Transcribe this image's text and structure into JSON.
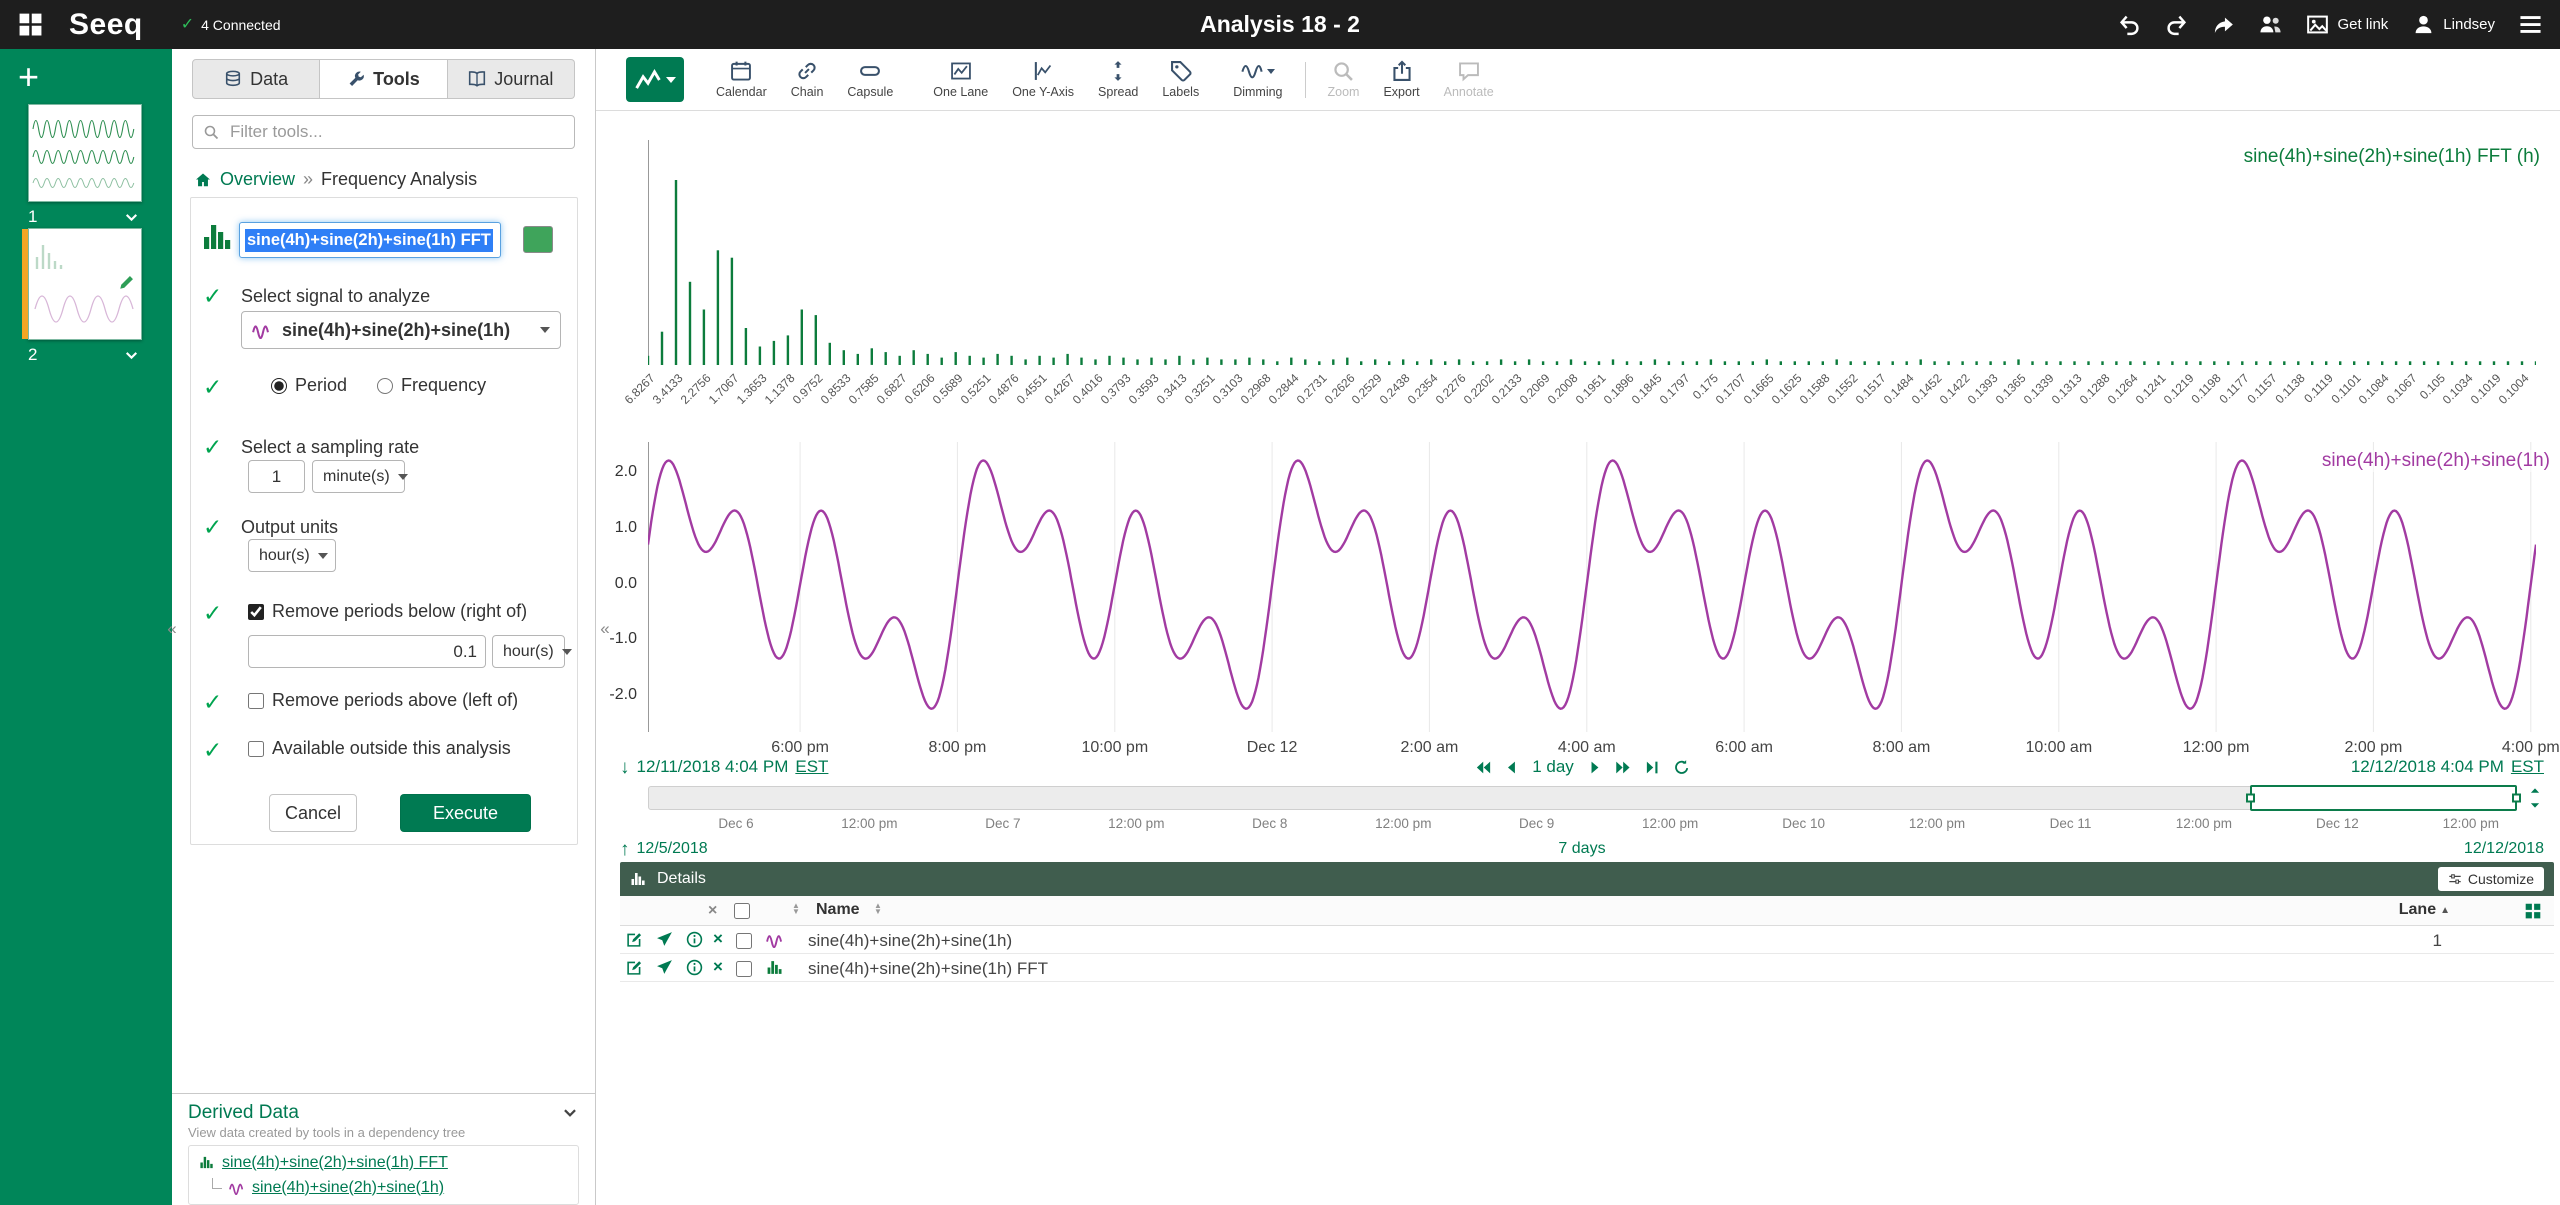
{
  "colors": {
    "accent_green": "#007a52",
    "sidebar_green": "#008659",
    "topbar_bg": "#1e1e1e",
    "fft_bar_green": "#0c7c3c",
    "signal_purple": "#a23ba2",
    "selection_blue": "#2f7ff6",
    "details_header_bg": "#405d4e",
    "active_worksheet_orange": "#f5a623",
    "swatch_green": "#3fa45b"
  },
  "topbar": {
    "logo": "Seeq",
    "connected_label": "4 Connected",
    "title": "Analysis 18 - 2",
    "get_link_label": "Get link",
    "user_name": "Lindsey"
  },
  "sidebar": {
    "worksheets": [
      {
        "number": "1"
      },
      {
        "number": "2",
        "active": true
      }
    ]
  },
  "toolpanel": {
    "tabs": {
      "data": "Data",
      "tools": "Tools",
      "journal": "Journal"
    },
    "filter_placeholder": "Filter tools...",
    "breadcrumb": {
      "root": "Overview",
      "separator": "»",
      "current": "Frequency Analysis"
    },
    "form": {
      "name_value": "sine(4h)+sine(2h)+sine(1h) FFT",
      "signal_label": "Select signal to analyze",
      "signal_value": "sine(4h)+sine(2h)+sine(1h)",
      "radio_period": "Period",
      "radio_frequency": "Frequency",
      "period_selected": true,
      "sampling_label": "Select a sampling rate",
      "sampling_value": "1",
      "sampling_unit": "minute(s)",
      "output_label": "Output units",
      "output_unit": "hour(s)",
      "below_label": "Remove periods below (right of)",
      "below_checked": true,
      "below_value": "0.1",
      "below_unit": "hour(s)",
      "above_label": "Remove periods above (left of)",
      "above_checked": false,
      "available_label": "Available outside this analysis",
      "available_checked": false,
      "cancel_label": "Cancel",
      "execute_label": "Execute"
    },
    "derived": {
      "title": "Derived Data",
      "subtitle": "View data created by tools in a dependency tree",
      "items": [
        "sine(4h)+sine(2h)+sine(1h) FFT",
        "sine(4h)+sine(2h)+sine(1h)"
      ]
    }
  },
  "toolbar": {
    "items": [
      {
        "label": "Calendar",
        "disabled": false
      },
      {
        "label": "Chain",
        "disabled": false
      },
      {
        "label": "Capsule",
        "disabled": false
      },
      {
        "label": "One Lane",
        "disabled": false
      },
      {
        "label": "One Y-Axis",
        "disabled": false
      },
      {
        "label": "Spread",
        "disabled": false
      },
      {
        "label": "Labels",
        "disabled": false
      },
      {
        "label": "Dimming",
        "disabled": false
      },
      {
        "label": "Zoom",
        "disabled": true
      },
      {
        "label": "Export",
        "disabled": false
      },
      {
        "label": "Annotate",
        "disabled": true
      }
    ]
  },
  "chart_data": [
    {
      "type": "bar",
      "series_label": "sine(4h)+sine(2h)+sine(1h) FFT (h)",
      "x_axis": "period in hours, descending (period = 6.8267/k)",
      "x_tick_labels": [
        "6.8267",
        "3.4133",
        "2.2756",
        "1.7067",
        "1.3653",
        "1.1378",
        "0.9752",
        "0.8533",
        "0.7585",
        "0.6827",
        "0.6206",
        "0.5689",
        "0.5251",
        "0.4876",
        "0.4551",
        "0.4267",
        "0.4016",
        "0.3793",
        "0.3593",
        "0.3413",
        "0.3251",
        "0.3103",
        "0.2968",
        "0.2844",
        "0.2731",
        "0.2626",
        "0.2529",
        "0.2438",
        "0.2354",
        "0.2276",
        "0.2202",
        "0.2133",
        "0.2069",
        "0.2008",
        "0.1951",
        "0.1896",
        "0.1845",
        "0.1797",
        "0.175",
        "0.1707",
        "0.1665",
        "0.1625",
        "0.1588",
        "0.1552",
        "0.1517",
        "0.1484",
        "0.1452",
        "0.1422",
        "0.1393",
        "0.1365",
        "0.1339",
        "0.1313",
        "0.1288",
        "0.1264",
        "0.1241",
        "0.1219",
        "0.1198",
        "0.1177",
        "0.1157",
        "0.1138",
        "0.1119",
        "0.1101",
        "0.1084",
        "0.1067",
        "0.105",
        "0.1034",
        "0.1019",
        "0.1004"
      ],
      "bins_per_label": 2,
      "values": [
        0.05,
        0.18,
        1.0,
        0.45,
        0.3,
        0.62,
        0.58,
        0.2,
        0.1,
        0.13,
        0.16,
        0.3,
        0.27,
        0.12,
        0.08,
        0.06,
        0.09,
        0.07,
        0.05,
        0.08,
        0.06,
        0.04,
        0.07,
        0.05,
        0.04,
        0.06,
        0.05,
        0.03,
        0.05,
        0.04,
        0.06,
        0.04,
        0.03,
        0.05,
        0.04,
        0.03,
        0.04,
        0.03,
        0.05,
        0.03,
        0.04,
        0.03,
        0.03,
        0.04,
        0.03,
        0.02,
        0.04,
        0.03,
        0.02,
        0.03,
        0.04,
        0.02,
        0.03,
        0.02,
        0.03,
        0.02,
        0.03,
        0.02,
        0.03,
        0.02,
        0.02,
        0.03,
        0.02,
        0.03,
        0.02,
        0.02,
        0.03,
        0.02,
        0.02,
        0.03,
        0.02,
        0.02,
        0.03,
        0.02,
        0.02,
        0.02,
        0.03,
        0.02,
        0.02,
        0.02,
        0.03,
        0.02,
        0.02,
        0.02,
        0.02,
        0.03,
        0.02,
        0.02,
        0.02,
        0.02,
        0.02,
        0.03,
        0.02,
        0.02,
        0.02,
        0.02,
        0.02,
        0.02,
        0.03,
        0.02,
        0.02,
        0.02,
        0.02,
        0.02,
        0.02,
        0.02,
        0.02,
        0.02,
        0.02,
        0.02,
        0.02,
        0.02,
        0.02,
        0.02,
        0.02,
        0.02,
        0.02,
        0.02,
        0.02,
        0.02,
        0.02,
        0.02,
        0.02,
        0.02,
        0.02,
        0.02,
        0.02,
        0.02,
        0.02,
        0.02,
        0.02,
        0.02,
        0.02,
        0.02,
        0.02,
        0.02
      ],
      "ylim": [
        0,
        1
      ],
      "peaks_at_period_hours": [
        4,
        2,
        1
      ]
    },
    {
      "type": "line",
      "series_label": "sine(4h)+sine(2h)+sine(1h)",
      "components": [
        {
          "period_hours": 4,
          "amplitude": 1
        },
        {
          "period_hours": 2,
          "amplitude": 1
        },
        {
          "period_hours": 1,
          "amplitude": 1
        }
      ],
      "start_offset_hours": 16.0667,
      "duration_hours": 24,
      "first_tick_offset_hours": 1.9333,
      "tick_interval_hours": 2,
      "x_tick_labels": [
        "6:00 pm",
        "8:00 pm",
        "10:00 pm",
        "Dec 12",
        "2:00 am",
        "4:00 am",
        "6:00 am",
        "8:00 am",
        "10:00 am",
        "12:00 pm",
        "2:00 pm",
        "4:00 pm"
      ],
      "yticks": [
        "2.0",
        "1.0",
        "0.0",
        "-1.0",
        "-2.0"
      ],
      "ylim": [
        -2.6,
        2.6
      ],
      "lane": "1"
    }
  ],
  "daterange": {
    "start": "12/11/2018 4:04 PM",
    "start_tz": "EST",
    "end": "12/12/2018 4:04 PM",
    "end_tz": "EST",
    "duration_label": "1 day"
  },
  "timeline": {
    "labels": [
      "Dec 6",
      "12:00 pm",
      "Dec 7",
      "12:00 pm",
      "Dec 8",
      "12:00 pm",
      "Dec 9",
      "12:00 pm",
      "Dec 10",
      "12:00 pm",
      "Dec 11",
      "12:00 pm",
      "Dec 12",
      "12:00 pm"
    ],
    "investigate_start": "12/5/2018",
    "investigate_end": "12/12/2018",
    "duration_label": "7 days",
    "selected_start_frac": 0.857,
    "selected_end_frac": 1.0
  },
  "details": {
    "title": "Details",
    "customize_label": "Customize",
    "name_column": "Name",
    "lane_column": "Lane",
    "rows": [
      {
        "name": "sine(4h)+sine(2h)+sine(1h)",
        "lane": "1",
        "icon": "signal"
      },
      {
        "name": "sine(4h)+sine(2h)+sine(1h) FFT",
        "lane": "",
        "icon": "histogram"
      }
    ]
  }
}
